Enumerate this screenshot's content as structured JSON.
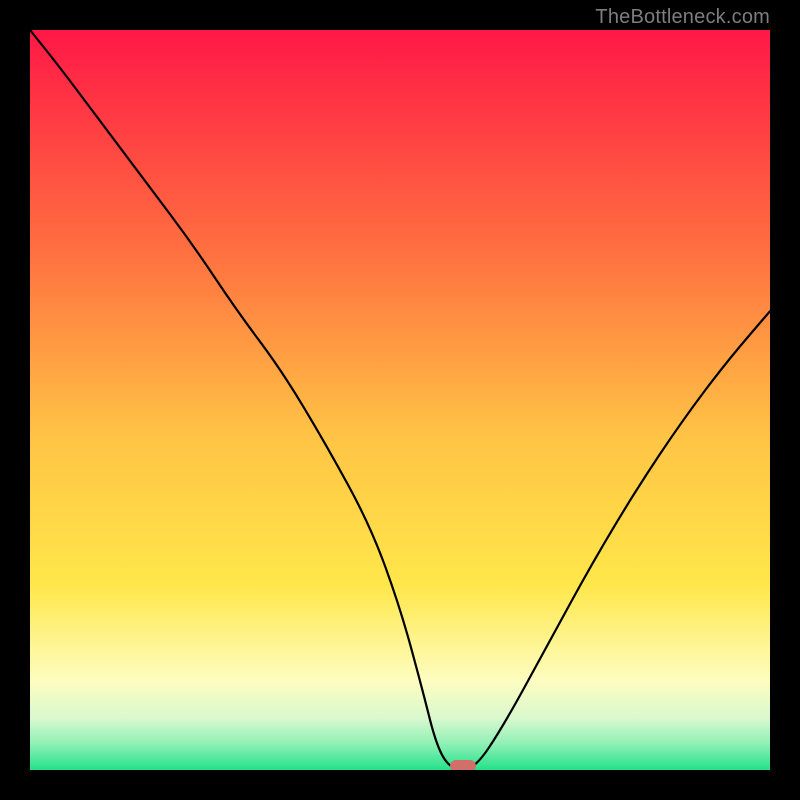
{
  "watermark": "TheBottleneck.com",
  "colors": {
    "black": "#000000",
    "top": "#ff1846",
    "orange": "#ff944a",
    "yellow": "#ffe74a",
    "pale_yellow": "#fdfdc0",
    "green_soft": "#a6f5c3",
    "green": "#23e28a",
    "curve": "#000000",
    "marker_fill": "#d07068",
    "watermark_text": "#7d7d7d"
  },
  "chart_data": {
    "type": "line",
    "title": "",
    "xlabel": "",
    "ylabel": "",
    "xlim": [
      0,
      100
    ],
    "ylim": [
      0,
      100
    ],
    "gradient_stops": [
      {
        "offset": 0.0,
        "color": "#ff1846"
      },
      {
        "offset": 0.3,
        "color": "#ff7040"
      },
      {
        "offset": 0.55,
        "color": "#ffc445"
      },
      {
        "offset": 0.75,
        "color": "#ffe74a"
      },
      {
        "offset": 0.88,
        "color": "#fdfdc0"
      },
      {
        "offset": 0.93,
        "color": "#d9f8ce"
      },
      {
        "offset": 0.965,
        "color": "#8ef0b5"
      },
      {
        "offset": 1.0,
        "color": "#23e28a"
      }
    ],
    "series": [
      {
        "name": "bottleneck-curve",
        "x": [
          0,
          4,
          10,
          16,
          22,
          28,
          34,
          40,
          46,
          50,
          53,
          55,
          57,
          60,
          64,
          70,
          76,
          82,
          88,
          94,
          100
        ],
        "values": [
          100,
          95,
          87,
          79,
          71,
          62,
          54,
          44,
          33,
          22,
          11,
          3,
          0,
          0,
          6,
          17,
          28,
          38,
          47,
          55,
          62
        ]
      }
    ],
    "marker": {
      "x": 58.5,
      "y": 0.5,
      "w": 3.5,
      "h": 1.6
    }
  }
}
